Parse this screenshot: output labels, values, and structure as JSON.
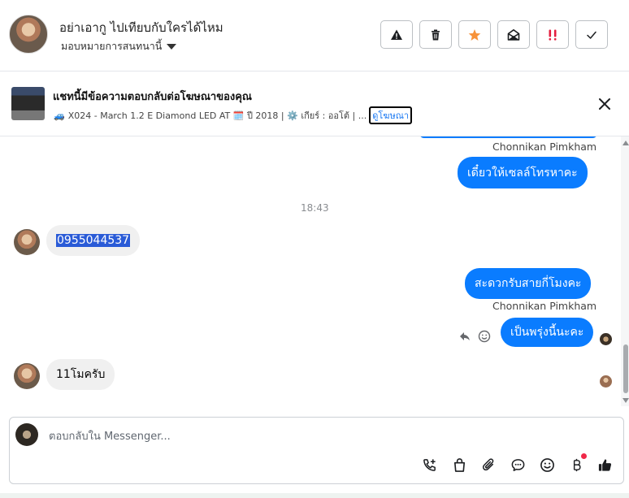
{
  "header": {
    "title": "อย่าเอากู ไปเทียบกับใครได้ไหม",
    "assign_label": "มอบหมายการสนทนานี้"
  },
  "ad": {
    "title": "แชทนี้มีข้อความตอบกลับต่อโฆษณาของคุณ",
    "description": "X024 - March 1.2 E Diamond LED AT 🗓️ ปี 2018 | ⚙️ เกียร์ : ออโต้ | ...",
    "link_label": "ดูโฆษณา"
  },
  "messages": [
    {
      "sender": "Chonnikan Pimkham",
      "text": "เดี๋ยวให้เซลล์โทรหาคะ"
    },
    {
      "time": "18:43"
    },
    {
      "text": "0955044537"
    },
    {
      "text": "สะดวกรับสายกี่โมงคะ"
    },
    {
      "sender": "Chonnikan Pimkham",
      "text": "เป็นพรุ่งนี้นะคะ"
    },
    {
      "text": "11โมครับ"
    }
  ],
  "composer": {
    "placeholder": "ตอบกลับใน Messenger..."
  },
  "colors": {
    "outgoing_bubble": "#0a7cff",
    "incoming_bubble": "#f0f0f0",
    "star": "#f7923a",
    "important": "#e41e3f",
    "notification_dot": "#f02849"
  },
  "icons": [
    "warning-icon",
    "trash-icon",
    "star-icon",
    "envelope-open-icon",
    "important-icon",
    "check-icon",
    "close-icon",
    "reply-icon",
    "emoji-react-icon",
    "call-add-icon",
    "shopping-bag-icon",
    "paperclip-icon",
    "saved-reply-icon",
    "emoji-icon",
    "baht-icon",
    "thumbs-up-icon"
  ]
}
